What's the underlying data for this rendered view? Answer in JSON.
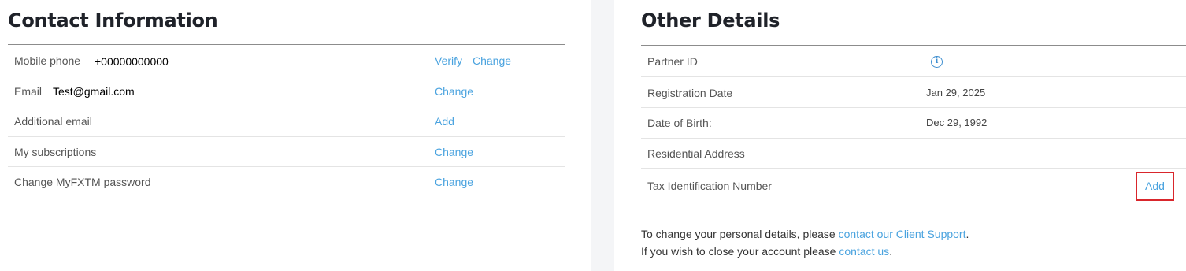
{
  "contact": {
    "title": "Contact Information",
    "rows": [
      {
        "label": "Mobile phone",
        "value": "+00000000000",
        "actions": [
          "Verify",
          "Change"
        ]
      },
      {
        "label": "Email",
        "value": "Test@gmail.com",
        "actions": [
          "Change"
        ]
      },
      {
        "label": "Additional email",
        "actions": [
          "Add"
        ]
      },
      {
        "label": "My subscriptions",
        "actions": [
          "Change"
        ]
      },
      {
        "label": "Change MyFXTM password",
        "actions": [
          "Change"
        ]
      }
    ]
  },
  "other": {
    "title": "Other Details",
    "rows": [
      {
        "label": "Partner ID",
        "icon": "info-icon"
      },
      {
        "label": "Registration Date",
        "value": "Jan 29, 2025"
      },
      {
        "label": "Date of Birth:",
        "value": "Dec 29, 1992"
      },
      {
        "label": "Residential Address"
      },
      {
        "label": "Tax Identification Number",
        "action": "Add"
      }
    ],
    "footer": {
      "line1_prefix": "To change your personal details, please ",
      "line1_link": "contact our Client Support",
      "line1_suffix": ".",
      "line2_prefix": "If you wish to close your account please ",
      "line2_link": "contact us",
      "line2_suffix": "."
    }
  },
  "colors": {
    "link": "#4aa3df",
    "highlight": "#d9262c"
  }
}
